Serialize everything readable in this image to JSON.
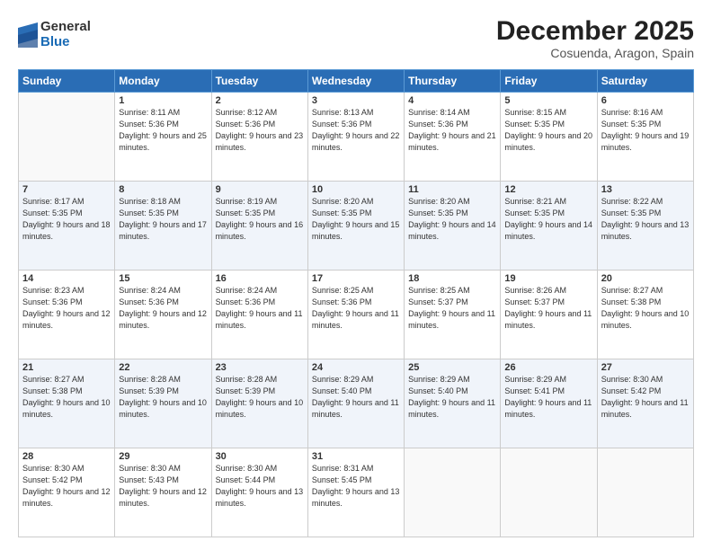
{
  "logo": {
    "general": "General",
    "blue": "Blue"
  },
  "title": "December 2025",
  "location": "Cosuenda, Aragon, Spain",
  "header_days": [
    "Sunday",
    "Monday",
    "Tuesday",
    "Wednesday",
    "Thursday",
    "Friday",
    "Saturday"
  ],
  "weeks": [
    [
      {
        "day": "",
        "info": ""
      },
      {
        "day": "1",
        "info": "Sunrise: 8:11 AM\nSunset: 5:36 PM\nDaylight: 9 hours\nand 25 minutes."
      },
      {
        "day": "2",
        "info": "Sunrise: 8:12 AM\nSunset: 5:36 PM\nDaylight: 9 hours\nand 23 minutes."
      },
      {
        "day": "3",
        "info": "Sunrise: 8:13 AM\nSunset: 5:36 PM\nDaylight: 9 hours\nand 22 minutes."
      },
      {
        "day": "4",
        "info": "Sunrise: 8:14 AM\nSunset: 5:36 PM\nDaylight: 9 hours\nand 21 minutes."
      },
      {
        "day": "5",
        "info": "Sunrise: 8:15 AM\nSunset: 5:35 PM\nDaylight: 9 hours\nand 20 minutes."
      },
      {
        "day": "6",
        "info": "Sunrise: 8:16 AM\nSunset: 5:35 PM\nDaylight: 9 hours\nand 19 minutes."
      }
    ],
    [
      {
        "day": "7",
        "info": "Sunrise: 8:17 AM\nSunset: 5:35 PM\nDaylight: 9 hours\nand 18 minutes."
      },
      {
        "day": "8",
        "info": "Sunrise: 8:18 AM\nSunset: 5:35 PM\nDaylight: 9 hours\nand 17 minutes."
      },
      {
        "day": "9",
        "info": "Sunrise: 8:19 AM\nSunset: 5:35 PM\nDaylight: 9 hours\nand 16 minutes."
      },
      {
        "day": "10",
        "info": "Sunrise: 8:20 AM\nSunset: 5:35 PM\nDaylight: 9 hours\nand 15 minutes."
      },
      {
        "day": "11",
        "info": "Sunrise: 8:20 AM\nSunset: 5:35 PM\nDaylight: 9 hours\nand 14 minutes."
      },
      {
        "day": "12",
        "info": "Sunrise: 8:21 AM\nSunset: 5:35 PM\nDaylight: 9 hours\nand 14 minutes."
      },
      {
        "day": "13",
        "info": "Sunrise: 8:22 AM\nSunset: 5:35 PM\nDaylight: 9 hours\nand 13 minutes."
      }
    ],
    [
      {
        "day": "14",
        "info": "Sunrise: 8:23 AM\nSunset: 5:36 PM\nDaylight: 9 hours\nand 12 minutes."
      },
      {
        "day": "15",
        "info": "Sunrise: 8:24 AM\nSunset: 5:36 PM\nDaylight: 9 hours\nand 12 minutes."
      },
      {
        "day": "16",
        "info": "Sunrise: 8:24 AM\nSunset: 5:36 PM\nDaylight: 9 hours\nand 11 minutes."
      },
      {
        "day": "17",
        "info": "Sunrise: 8:25 AM\nSunset: 5:36 PM\nDaylight: 9 hours\nand 11 minutes."
      },
      {
        "day": "18",
        "info": "Sunrise: 8:25 AM\nSunset: 5:37 PM\nDaylight: 9 hours\nand 11 minutes."
      },
      {
        "day": "19",
        "info": "Sunrise: 8:26 AM\nSunset: 5:37 PM\nDaylight: 9 hours\nand 11 minutes."
      },
      {
        "day": "20",
        "info": "Sunrise: 8:27 AM\nSunset: 5:38 PM\nDaylight: 9 hours\nand 10 minutes."
      }
    ],
    [
      {
        "day": "21",
        "info": "Sunrise: 8:27 AM\nSunset: 5:38 PM\nDaylight: 9 hours\nand 10 minutes."
      },
      {
        "day": "22",
        "info": "Sunrise: 8:28 AM\nSunset: 5:39 PM\nDaylight: 9 hours\nand 10 minutes."
      },
      {
        "day": "23",
        "info": "Sunrise: 8:28 AM\nSunset: 5:39 PM\nDaylight: 9 hours\nand 10 minutes."
      },
      {
        "day": "24",
        "info": "Sunrise: 8:29 AM\nSunset: 5:40 PM\nDaylight: 9 hours\nand 11 minutes."
      },
      {
        "day": "25",
        "info": "Sunrise: 8:29 AM\nSunset: 5:40 PM\nDaylight: 9 hours\nand 11 minutes."
      },
      {
        "day": "26",
        "info": "Sunrise: 8:29 AM\nSunset: 5:41 PM\nDaylight: 9 hours\nand 11 minutes."
      },
      {
        "day": "27",
        "info": "Sunrise: 8:30 AM\nSunset: 5:42 PM\nDaylight: 9 hours\nand 11 minutes."
      }
    ],
    [
      {
        "day": "28",
        "info": "Sunrise: 8:30 AM\nSunset: 5:42 PM\nDaylight: 9 hours\nand 12 minutes."
      },
      {
        "day": "29",
        "info": "Sunrise: 8:30 AM\nSunset: 5:43 PM\nDaylight: 9 hours\nand 12 minutes."
      },
      {
        "day": "30",
        "info": "Sunrise: 8:30 AM\nSunset: 5:44 PM\nDaylight: 9 hours\nand 13 minutes."
      },
      {
        "day": "31",
        "info": "Sunrise: 8:31 AM\nSunset: 5:45 PM\nDaylight: 9 hours\nand 13 minutes."
      },
      {
        "day": "",
        "info": ""
      },
      {
        "day": "",
        "info": ""
      },
      {
        "day": "",
        "info": ""
      }
    ]
  ]
}
